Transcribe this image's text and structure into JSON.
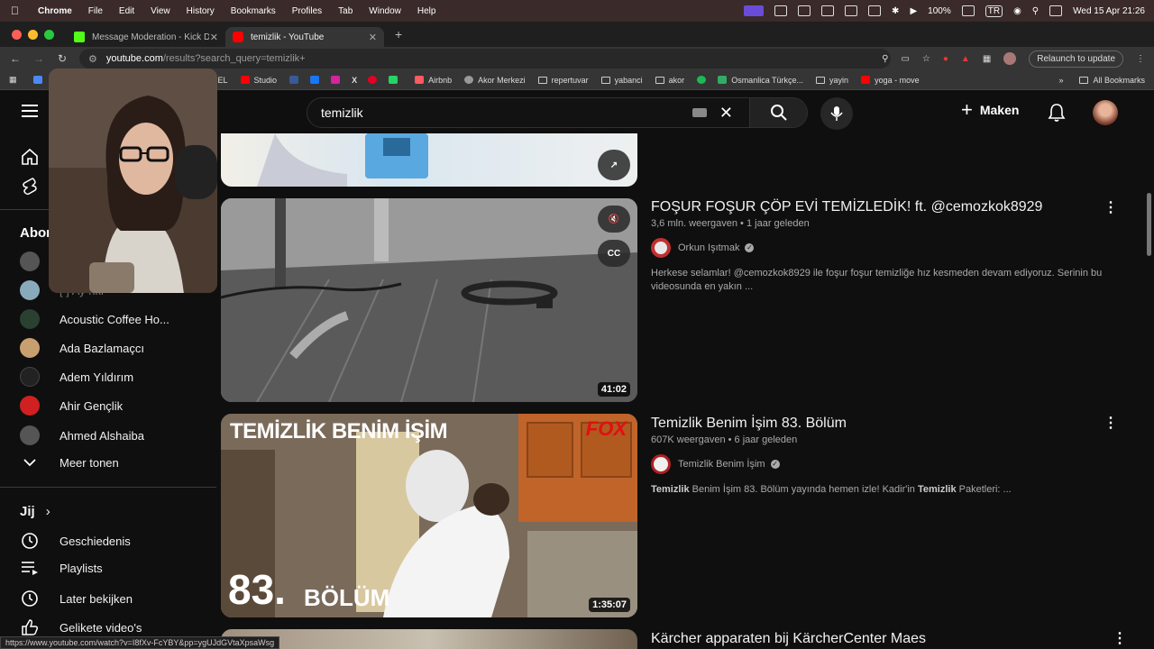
{
  "menubar": {
    "items": [
      "Chrome",
      "File",
      "Edit",
      "View",
      "History",
      "Bookmarks",
      "Profiles",
      "Tab",
      "Window",
      "Help"
    ],
    "battery": "100%",
    "input_lang": "TR",
    "datetime": "Wed 15 Apr  21:26"
  },
  "tabs": [
    {
      "title": "Message Moderation - Kick D",
      "favicon_color": "#53fc18"
    },
    {
      "title": "temizlik - YouTube",
      "favicon_color": "#ff0000"
    }
  ],
  "toolbar": {
    "url_host": "youtube.com",
    "url_path": "/results?search_query=temizlik+",
    "relaunch_label": "Relaunch to update"
  },
  "bookmarks": {
    "items": [
      {
        "label": "BEL",
        "kind": "text"
      },
      {
        "label": "Studio",
        "kind": "youtube"
      },
      {
        "label": "Airbnb",
        "kind": "airbnb"
      },
      {
        "label": "Akor Merkezi",
        "kind": "site"
      },
      {
        "label": "repertuvar",
        "kind": "folder"
      },
      {
        "label": "yabanci",
        "kind": "folder"
      },
      {
        "label": "akor",
        "kind": "folder"
      },
      {
        "label": "Osmanlica Türkçe...",
        "kind": "site"
      },
      {
        "label": "yayin",
        "kind": "folder"
      },
      {
        "label": "yoga - move",
        "kind": "youtube"
      }
    ],
    "all_label": "All Bookmarks"
  },
  "header": {
    "search_query": "temizlik",
    "create_label": "Maken"
  },
  "sidebar": {
    "subs_heading": "Abon",
    "subscriptions": [
      {
        "label": "[ ] Ay nki",
        "color": "#444"
      },
      {
        "label": "Acoustic Coffee Ho...",
        "color": "#2a4030"
      },
      {
        "label": "Ada Bazlamaçcı",
        "color": "#c8a070"
      },
      {
        "label": "Adem Yıldırım",
        "color": "#222"
      },
      {
        "label": "Ahir Gençlik",
        "color": "#d02020"
      },
      {
        "label": "Ahmed Alshaiba",
        "color": "#555"
      }
    ],
    "more_label": "Meer tonen",
    "you_heading": "Jij",
    "you_items": [
      {
        "label": "Geschiedenis",
        "icon": "history-icon"
      },
      {
        "label": "Playlists",
        "icon": "playlists-icon"
      },
      {
        "label": "Later bekijken",
        "icon": "watch-later-icon"
      },
      {
        "label": "Gelikete video's",
        "icon": "liked-icon"
      }
    ]
  },
  "results": [
    {
      "title": "FOŞUR FOŞUR ÇÖP EVİ TEMİZLEDİK! ft. @cemozkok8929",
      "meta": "3,6 mln. weergaven • 1 jaar geleden",
      "channel": "Orkun Işıtmak",
      "description": "Herkese selamlar!  @cemozkok8929 ile foşur foşur temizliğe hız kesmeden devam ediyoruz. Serinin bu videosunda en yakın ...",
      "duration": "41:02",
      "cc_label": "CC"
    },
    {
      "title": "Temizlik Benim İşim 83. Bölüm",
      "meta": "607K weergaven • 6 jaar geleden",
      "channel": "Temizlik Benim İşim",
      "description_bold": "Temizlik",
      "description_mid": " Benim İşim 83. Bölüm yayında hemen izle! Kadir'in ",
      "description_bold2": "Temizlik",
      "description_end": " Paketleri: ...",
      "duration": "1:35:07",
      "thumb_title": "TEMİZLİK BENİM İŞİM",
      "thumb_episode": "83.",
      "thumb_episode_word": "BÖLÜM",
      "thumb_network": "FOX"
    },
    {
      "title": "Kärcher apparaten bij KärcherCenter Maes"
    }
  ],
  "statusbar": {
    "url": "https://www.youtube.com/watch?v=I8fXv-FcYBY&pp=ygUJdGVtaXpsaWsg"
  },
  "colors": {
    "background": "#0f0f0f",
    "accent_red": "#ff0000",
    "menubar": "#3a2a2a"
  }
}
